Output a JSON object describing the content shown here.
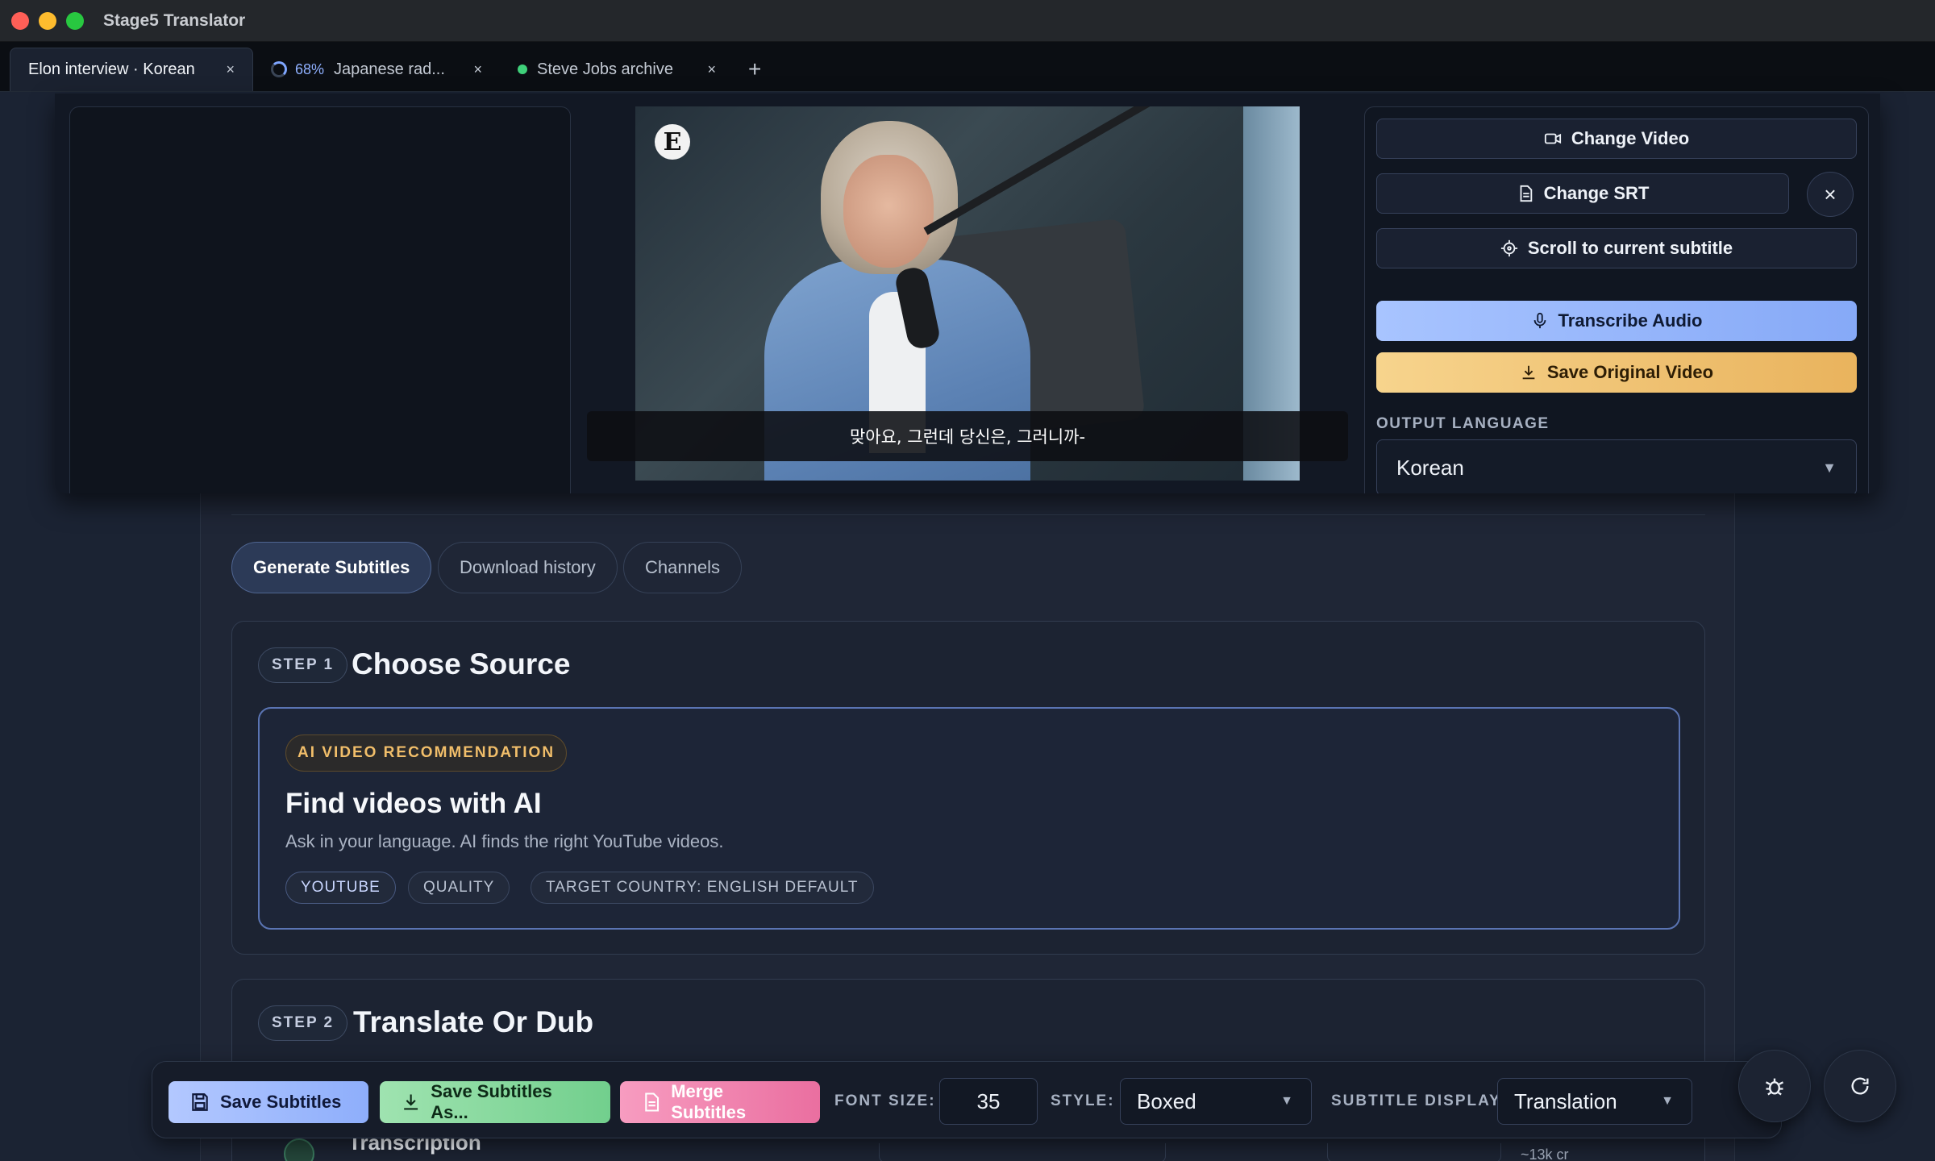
{
  "window": {
    "title": "Stage5 Translator"
  },
  "tabs": [
    {
      "label": "Elon interview · Korean",
      "close": "×"
    },
    {
      "progress": "68%",
      "label": "Japanese rad...",
      "close": "×"
    },
    {
      "label": "Steve Jobs archive",
      "close": "×"
    }
  ],
  "tab_add": "+",
  "video": {
    "logo": "E",
    "subtitle": "맞아요, 그런데 당신은, 그러니까-"
  },
  "side_panel": {
    "change_video": "Change Video",
    "change_srt": "Change SRT",
    "close": "×",
    "scroll_current": "Scroll to current subtitle",
    "transcribe": "Transcribe Audio",
    "save_original": "Save Original Video",
    "output_language_label": "OUTPUT LANGUAGE",
    "output_language": "Korean"
  },
  "nav_pills": [
    "Generate Subtitles",
    "Download history",
    "Channels"
  ],
  "step1": {
    "badge": "STEP 1",
    "title": "Choose Source",
    "ai_chip": "AI VIDEO RECOMMENDATION",
    "ai_title": "Find videos with AI",
    "ai_desc": "Ask in your language. AI finds the right YouTube videos.",
    "tags": [
      "YOUTUBE",
      "QUALITY",
      "TARGET COUNTRY: ENGLISH DEFAULT"
    ]
  },
  "step2": {
    "badge": "STEP 2",
    "title": "Translate Or Dub",
    "peek_label": "Transcription",
    "peek_credits": "~13k cr"
  },
  "toolbar": {
    "save": "Save Subtitles",
    "save_as": "Save Subtitles As...",
    "merge": "Merge Subtitles",
    "font_size_label": "FONT SIZE:",
    "font_size": "35",
    "style_label": "STYLE:",
    "style": "Boxed",
    "display_label": "SUBTITLE DISPLAY",
    "display": "Translation"
  },
  "colors": {
    "accent_blue": "#8eaefb",
    "accent_green": "#72cf8d",
    "accent_pink": "#ea6fa0",
    "accent_gold": "#e9b35d",
    "background": "#1b2333"
  },
  "icons": [
    "video-camera-icon",
    "document-icon",
    "target-icon",
    "microphone-icon",
    "download-icon",
    "save-disk-icon",
    "bug-icon",
    "refresh-icon"
  ]
}
